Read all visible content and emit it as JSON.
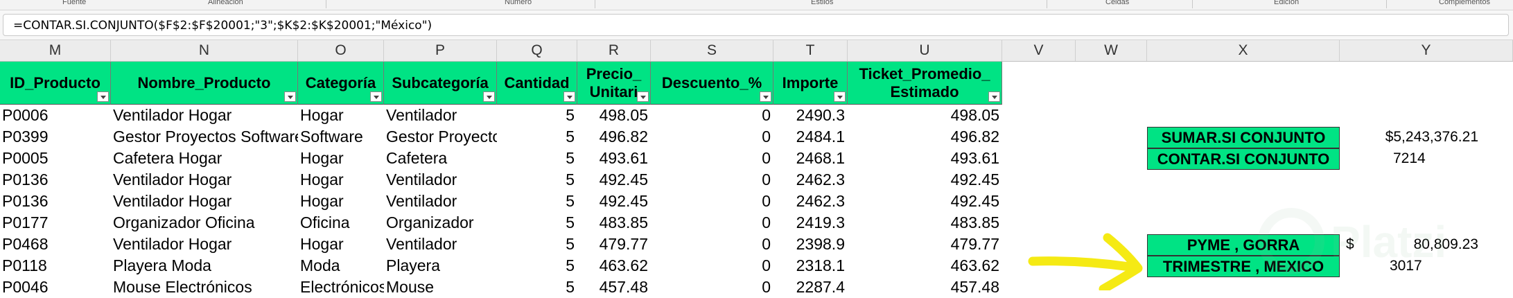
{
  "ribbon": {
    "groups": [
      "Fuente",
      "Alineación",
      "Número",
      "Estilos",
      "Celdas",
      "Edición",
      "Complementos"
    ]
  },
  "formula_bar": {
    "formula": "=CONTAR.SI.CONJUNTO($F$2:$F$20001;\"3\";$K$2:$K$20001;\"México\")"
  },
  "columns": [
    "M",
    "N",
    "O",
    "P",
    "Q",
    "R",
    "S",
    "T",
    "U",
    "V",
    "W",
    "X",
    "Y"
  ],
  "table": {
    "headers": [
      "ID_Producto",
      "Nombre_Producto",
      "Categoría",
      "Subcategoría",
      "Cantidad",
      "Precio_\nUnitari",
      "Descuento_%",
      "Importe",
      "Ticket_Promedio_\nEstimado"
    ],
    "rows": [
      [
        "P0006",
        "Ventilador Hogar",
        "Hogar",
        "Ventilador",
        "5",
        "498.05",
        "0",
        "2490.3",
        "498.05"
      ],
      [
        "P0399",
        "Gestor Proyectos Software",
        "Software",
        "Gestor Proyectos",
        "5",
        "496.82",
        "0",
        "2484.1",
        "496.82"
      ],
      [
        "P0005",
        "Cafetera Hogar",
        "Hogar",
        "Cafetera",
        "5",
        "493.61",
        "0",
        "2468.1",
        "493.61"
      ],
      [
        "P0136",
        "Ventilador Hogar",
        "Hogar",
        "Ventilador",
        "5",
        "492.45",
        "0",
        "2462.3",
        "492.45"
      ],
      [
        "P0136",
        "Ventilador Hogar",
        "Hogar",
        "Ventilador",
        "5",
        "492.45",
        "0",
        "2462.3",
        "492.45"
      ],
      [
        "P0177",
        "Organizador Oficina",
        "Oficina",
        "Organizador",
        "5",
        "483.85",
        "0",
        "2419.3",
        "483.85"
      ],
      [
        "P0468",
        "Ventilador Hogar",
        "Hogar",
        "Ventilador",
        "5",
        "479.77",
        "0",
        "2398.9",
        "479.77"
      ],
      [
        "P0118",
        "Playera Moda",
        "Moda",
        "Playera",
        "5",
        "463.62",
        "0",
        "2318.1",
        "463.62"
      ],
      [
        "P0046",
        "Mouse Electrónicos",
        "Electrónicos",
        "Mouse",
        "5",
        "457.48",
        "0",
        "2287.4",
        "457.48"
      ]
    ]
  },
  "summary": {
    "sumar_label": "SUMAR.SI CONJUNTO",
    "sumar_value": "$5,243,376.21",
    "contar_label": "CONTAR.SI CONJUNTO",
    "contar_value": "7214",
    "pyme_label": "PYME , GORRA",
    "pyme_currency": "$",
    "pyme_value": "80,809.23",
    "trimestre_label": "TRIMESTRE , MEXICO",
    "trimestre_value": "3017"
  },
  "watermark": {
    "text": "Platzi",
    "logo_name": "platzi-logo-icon"
  },
  "annotation": {
    "arrow_color": "#f5ea14",
    "arrow_name": "highlighter-arrow"
  },
  "colors": {
    "header_green": "#00e384",
    "grid_header": "#ececec"
  }
}
